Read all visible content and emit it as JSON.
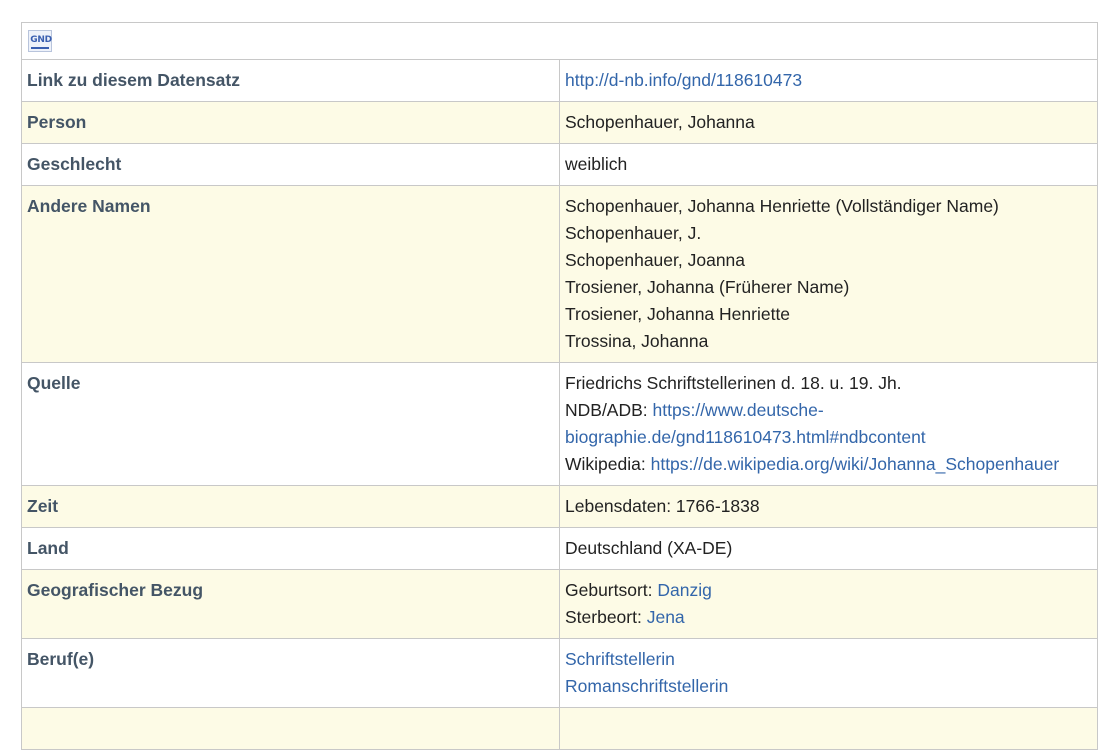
{
  "logo": {
    "text": "GND",
    "icon": "gnd-logo-icon"
  },
  "rows": {
    "link": {
      "label": "Link zu diesem Datensatz",
      "value": "http://d-nb.info/gnd/118610473"
    },
    "person": {
      "label": "Person",
      "value": "Schopenhauer, Johanna"
    },
    "geschlecht": {
      "label": "Geschlecht",
      "value": "weiblich"
    },
    "andere_namen": {
      "label": "Andere Namen",
      "values": [
        "Schopenhauer, Johanna Henriette (Vollständiger Name)",
        "Schopenhauer, J.",
        "Schopenhauer, Joanna",
        "Trosiener, Johanna (Früherer Name)",
        "Trosiener, Johanna Henriette",
        "Trossina, Johanna"
      ]
    },
    "quelle": {
      "label": "Quelle",
      "line1": "Friedrichs Schriftstellerinen d. 18. u. 19. Jh.",
      "ndb_prefix": "NDB/ADB: ",
      "ndb_link": "https://www.deutsche-biographie.de/gnd118610473.html#ndbcontent",
      "wiki_prefix": "Wikipedia: ",
      "wiki_link": "https://de.wikipedia.org/wiki/Johanna_Schopenhauer"
    },
    "zeit": {
      "label": "Zeit",
      "value": "Lebensdaten: 1766-1838"
    },
    "land": {
      "label": "Land",
      "value": "Deutschland (XA-DE)"
    },
    "geo": {
      "label": "Geografischer Bezug",
      "birth_prefix": "Geburtsort: ",
      "birth_place": "Danzig",
      "death_prefix": "Sterbeort: ",
      "death_place": "Jena"
    },
    "beruf": {
      "label": "Beruf(e)",
      "values": [
        "Schriftstellerin",
        "Romanschriftstellerin"
      ]
    }
  },
  "colors": {
    "link": "#3366aa",
    "label": "#445566",
    "row_alt": "#fdfbe6",
    "border": "#c8c8c8"
  }
}
